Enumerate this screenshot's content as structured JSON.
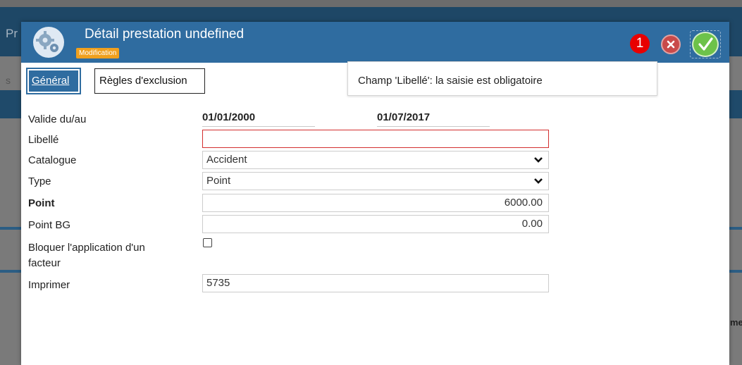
{
  "background": {
    "header_text": "Pr",
    "tab_text": "s",
    "side_text": "me"
  },
  "modal": {
    "title": "Détail prestation undefined",
    "mode_badge": "Modification",
    "notification_count": "1",
    "icons": {
      "app": "gears-icon",
      "cancel": "close-icon",
      "confirm": "check-icon"
    }
  },
  "tabs": [
    {
      "label": "Général",
      "active": true
    },
    {
      "label": "Règles d'exclusion",
      "active": false
    }
  ],
  "validation_message": "Champ 'Libellé': la saisie est obligatoire",
  "form": {
    "validity": {
      "label": "Valide du/au",
      "from": "01/01/2000",
      "to": "01/07/2017"
    },
    "libelle": {
      "label": "Libellé",
      "value": ""
    },
    "catalogue": {
      "label": "Catalogue",
      "value": "Accident"
    },
    "type": {
      "label": "Type",
      "value": "Point"
    },
    "point": {
      "label": "Point",
      "value": "6000.00"
    },
    "point_bg": {
      "label": "Point BG",
      "value": "0.00"
    },
    "bloquer": {
      "label_line1": "Bloquer l'application d'un",
      "label_line2": "facteur",
      "checked": false
    },
    "imprimer": {
      "label": "Imprimer",
      "value": "5735"
    }
  },
  "colors": {
    "header_blue": "#2f6ca0",
    "error_red": "#d32f2f",
    "badge_orange": "#f0a01e",
    "confirm_green": "#6dc24a",
    "cancel_red": "#c94a4a"
  }
}
